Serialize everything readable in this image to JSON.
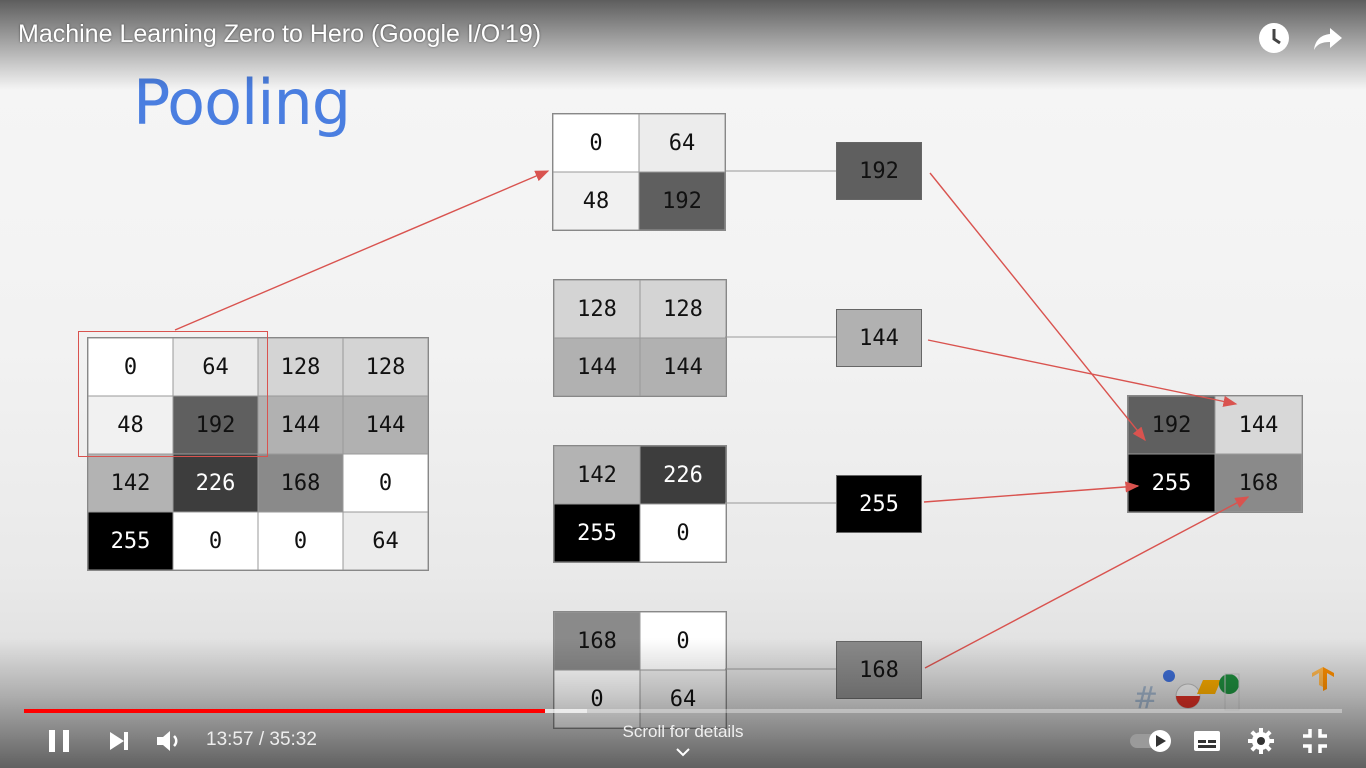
{
  "player": {
    "video_title": "Machine Learning Zero to Hero (Google I/O'19)",
    "icons": {
      "watch_later": "clock-icon",
      "share": "share-arrow-icon"
    }
  },
  "slide": {
    "title": "Pooling",
    "input_grid": [
      [
        "0",
        "64",
        "128",
        "128"
      ],
      [
        "48",
        "192",
        "144",
        "144"
      ],
      [
        "142",
        "226",
        "168",
        "0"
      ],
      [
        "255",
        "0",
        "0",
        "64"
      ]
    ],
    "blocks": [
      [
        "0",
        "64",
        "48",
        "192"
      ],
      [
        "128",
        "128",
        "144",
        "144"
      ],
      [
        "142",
        "226",
        "255",
        "0"
      ],
      [
        "168",
        "0",
        "0",
        "64"
      ]
    ],
    "maxima": [
      "192",
      "144",
      "255",
      "168"
    ],
    "output_grid": [
      "192",
      "144",
      "255",
      "168"
    ],
    "colors": {
      "accent_title": "#4a7ee0",
      "arrow": "#d9534f"
    }
  },
  "controls": {
    "current_time": "13:57",
    "separator": " / ",
    "duration": "35:32",
    "played_fraction": 0.395,
    "buffered_fraction": 0.427,
    "scroll_hint": "Scroll for details",
    "icons": [
      "pause-icon",
      "next-icon",
      "volume-icon",
      "autoplay-toggle-icon",
      "subtitles-icon",
      "settings-gear-icon",
      "exit-fullscreen-icon"
    ],
    "progress_color": "#ff0000"
  }
}
